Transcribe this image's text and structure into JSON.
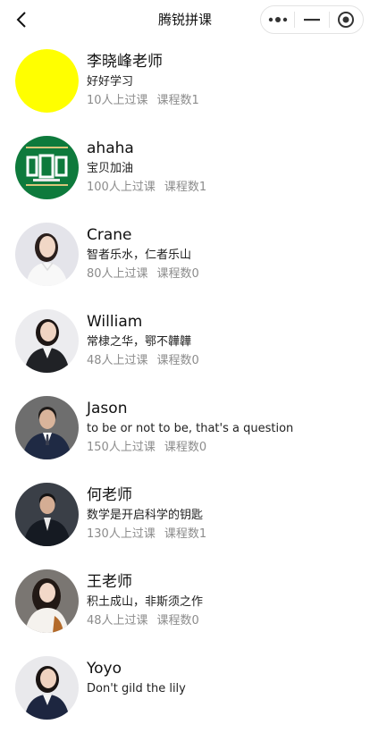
{
  "nav": {
    "title": "腾锐拼课"
  },
  "teachers": [
    {
      "name": "李晓峰老师",
      "motto": "好好学习",
      "students": "10人上过课",
      "courses": "课程数1",
      "avatar": "yellow-circle"
    },
    {
      "name": "ahaha",
      "motto": "宝贝加油",
      "students": "100人上过课",
      "courses": "课程数1",
      "avatar": "green-logo"
    },
    {
      "name": "Crane",
      "motto": "智者乐水，仁者乐山",
      "students": "80人上过课",
      "courses": "课程数0",
      "avatar": "portrait-woman-white"
    },
    {
      "name": "William",
      "motto": "常棣之华，鄂不韡韡",
      "students": "48人上过课",
      "courses": "课程数0",
      "avatar": "portrait-woman-dark"
    },
    {
      "name": "Jason",
      "motto": "to be or not to be, that's a question",
      "students": "150人上过课",
      "courses": "课程数0",
      "avatar": "portrait-man-suit"
    },
    {
      "name": "何老师",
      "motto": "数学是开启科学的钥匙",
      "students": "130人上过课",
      "courses": "课程数1",
      "avatar": "portrait-man-dark"
    },
    {
      "name": "王老师",
      "motto": "积土成山，非斯须之作",
      "students": "48人上过课",
      "courses": "课程数0",
      "avatar": "portrait-woman-curly"
    },
    {
      "name": "Yoyo",
      "motto": "Don't gild the lily",
      "students": "",
      "courses": "",
      "avatar": "portrait-woman-dark"
    }
  ]
}
